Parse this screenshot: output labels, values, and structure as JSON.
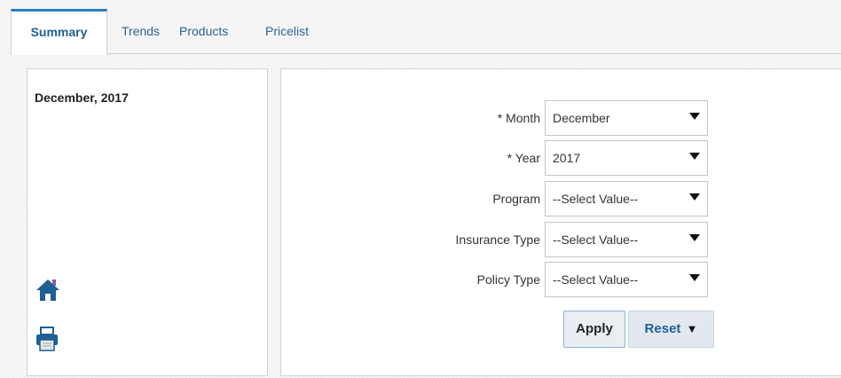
{
  "tabs": [
    {
      "label": "Summary",
      "active": true
    },
    {
      "label": "Trends",
      "active": false
    },
    {
      "label": "Products",
      "active": false
    },
    {
      "label": "Pricelist",
      "active": false
    }
  ],
  "left_panel": {
    "title": "December, 2017",
    "icons": [
      "home-icon",
      "printer-icon"
    ]
  },
  "filters": [
    {
      "label": "* Month",
      "value": "December"
    },
    {
      "label": "* Year",
      "value": "2017"
    },
    {
      "label": "Program",
      "value": "--Select Value--"
    },
    {
      "label": "Insurance Type",
      "value": "--Select Value--"
    },
    {
      "label": "Policy Type",
      "value": "--Select Value--"
    }
  ],
  "buttons": {
    "apply_label": "Apply",
    "reset_label": "Reset"
  },
  "colors": {
    "accent": "#2a7fc1",
    "link": "#2a6496",
    "home_icon": "#1e5f96",
    "home_chimney": "#8e5aa0"
  }
}
